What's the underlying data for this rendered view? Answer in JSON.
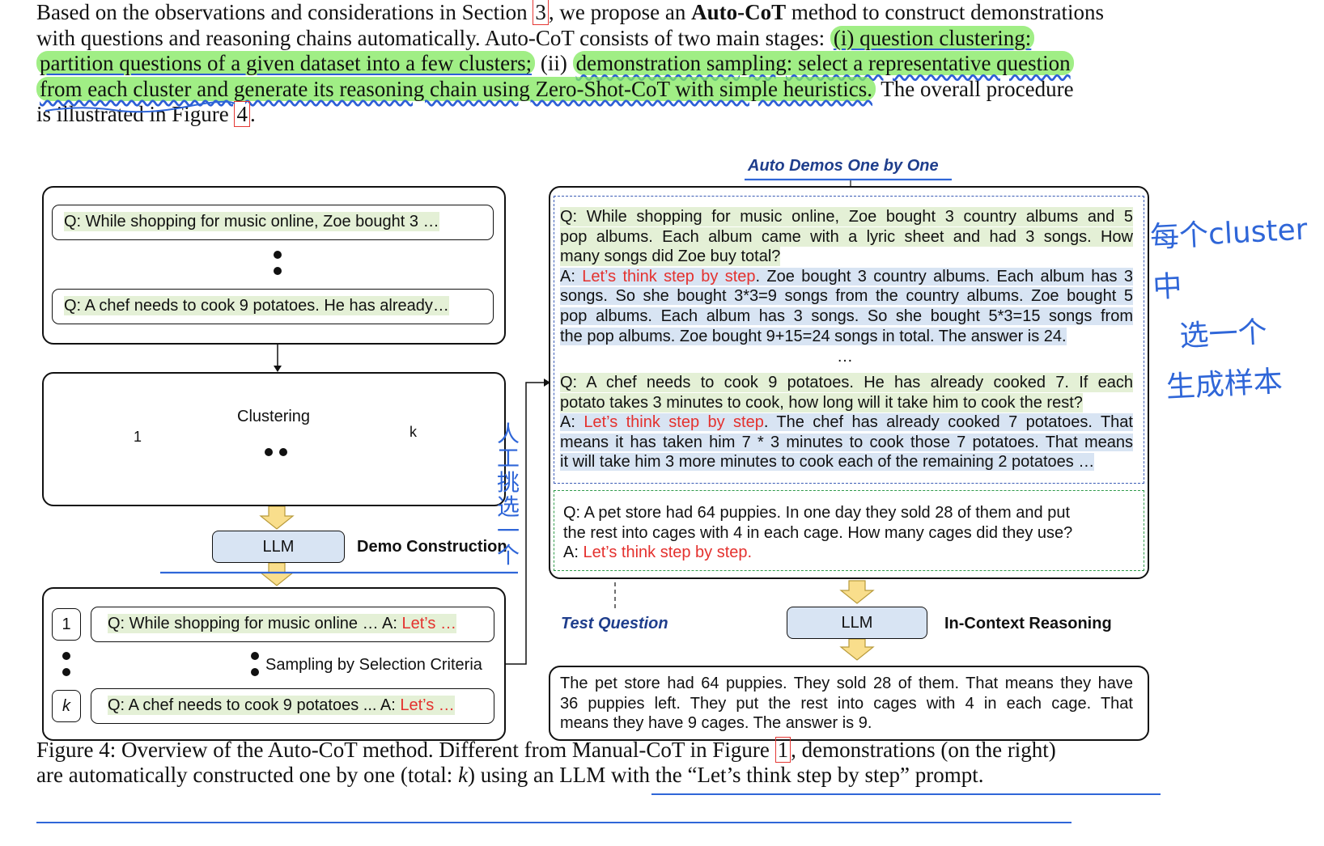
{
  "paragraph": {
    "l1_a": "Based on the observations and considerations in Section ",
    "l1_ref": "3",
    "l1_b": ", we propose an ",
    "l1_bold": "Auto-CoT",
    "l1_c": " method to construct demonstrations",
    "l2_a": "with questions and reasoning chains automatically.  Auto-CoT consists of two main stages: ",
    "l2_hl": "(i) question clustering:",
    "l3_hl": "partition questions of a given dataset into a few clusters;",
    "l3_b": " (ii) ",
    "l3_hl2": "demonstration sampling: select a representative question",
    "l4_hl": "from each cluster and generate its reasoning chain using Zero-Shot-CoT with simple heuristics.",
    "l4_b": " The overall procedure",
    "l5_a": "is illustrated in Figure ",
    "l5_ref": "4",
    "l5_b": "."
  },
  "left": {
    "q1": "Q: While shopping for music online, Zoe bought 3 …",
    "q2": "Q: A chef needs to cook 9 potatoes. He has already…",
    "clustering_label": "Clustering",
    "cluster1_label": "1",
    "clusterk_label": "k",
    "llm_label": "LLM",
    "demo_construction_label": "Demo Construction",
    "sample1_num": "1",
    "sample1_q": "Q: While shopping for music online … A: ",
    "sample1_red": "Let’s …",
    "samplek_num": "k",
    "samplek_q": "Q: A chef needs to cook 9 potatoes ... A: ",
    "samplek_red": "Let’s …",
    "sampling_label": "Sampling by Selection Criteria"
  },
  "right": {
    "auto_demos_label": "Auto Demos One by One",
    "demo1_q_l1": "Q: While shopping for music online, Zoe bought 3 country albums and 5",
    "demo1_q_l2": "pop albums. Each album came with a lyric sheet and had 3 songs. How",
    "demo1_q_l3": "many songs did Zoe buy total?",
    "demo1_a_prefix": "A: ",
    "demo1_a_red": "Let’s think step by step",
    "demo1_a_l1": ". Zoe bought 3 country albums. Each album has 3",
    "demo1_a_l2": "songs. So she bought 3*3=9 songs from the country albums. Zoe bought 5",
    "demo1_a_l3": "pop albums. Each album has 3 songs. So she bought 5*3=15 songs from",
    "demo1_a_l4": "the pop albums. Zoe bought 9+15=24 songs in total. The answer is 24.",
    "ellipsis": "…",
    "demo2_q_l1": "Q: A chef needs to cook 9 potatoes. He has already cooked 7. If each",
    "demo2_q_l2": "potato takes 3 minutes to cook, how long will it take him to cook the rest?",
    "demo2_a_prefix": "A: ",
    "demo2_a_red": "Let’s think step by step",
    "demo2_a_l1": ". The chef has already cooked 7 potatoes. That",
    "demo2_a_l2": "means it has taken him 7 * 3 minutes to cook those 7 potatoes. That means",
    "demo2_a_l3": "it will take him 3 more minutes to cook each of the remaining 2 potatoes …",
    "test_q_l1": "Q: A pet store had 64 puppies. In one day they sold 28 of them and put",
    "test_q_l2": "the rest into cages with 4 in each cage. How many cages did they use?",
    "test_a_prefix": "A: ",
    "test_a_red": "Let’s think step by step.",
    "test_question_label": "Test Question",
    "llm_label": "LLM",
    "icr_label": "In-Context Reasoning",
    "answer_l1": "The pet store had 64 puppies. They sold 28 of them. That means they have",
    "answer_l2": "36 puppies left. They put the rest into cages with 4 in each cage. That",
    "answer_l3": "means they have 9 cages. The answer is 9."
  },
  "caption": {
    "a": "Figure 4: Overview of the Auto-CoT method. Different from ",
    "b": "Manual-CoT in Figure ",
    "ref": "1",
    "c": ", demonstrations (on the right)",
    "d": "are automatically constructed one by one (total: ",
    "k": "k",
    "e": ") using an LLM with the “Let’s think step by step” prompt."
  },
  "handwriting": {
    "note1_l1": "每个cluster中",
    "note1_l2": "选一个",
    "note1_l3": "生成样本",
    "note2": "人工挑选一个"
  },
  "colors": {
    "highlight_green": "#80e85c",
    "demo_green": "#e4f0d6",
    "demo_blue": "#d8e4f3",
    "red_text": "#e4312e",
    "annotation_blue": "#2f66d8",
    "label_blue": "#1f3e8c"
  }
}
